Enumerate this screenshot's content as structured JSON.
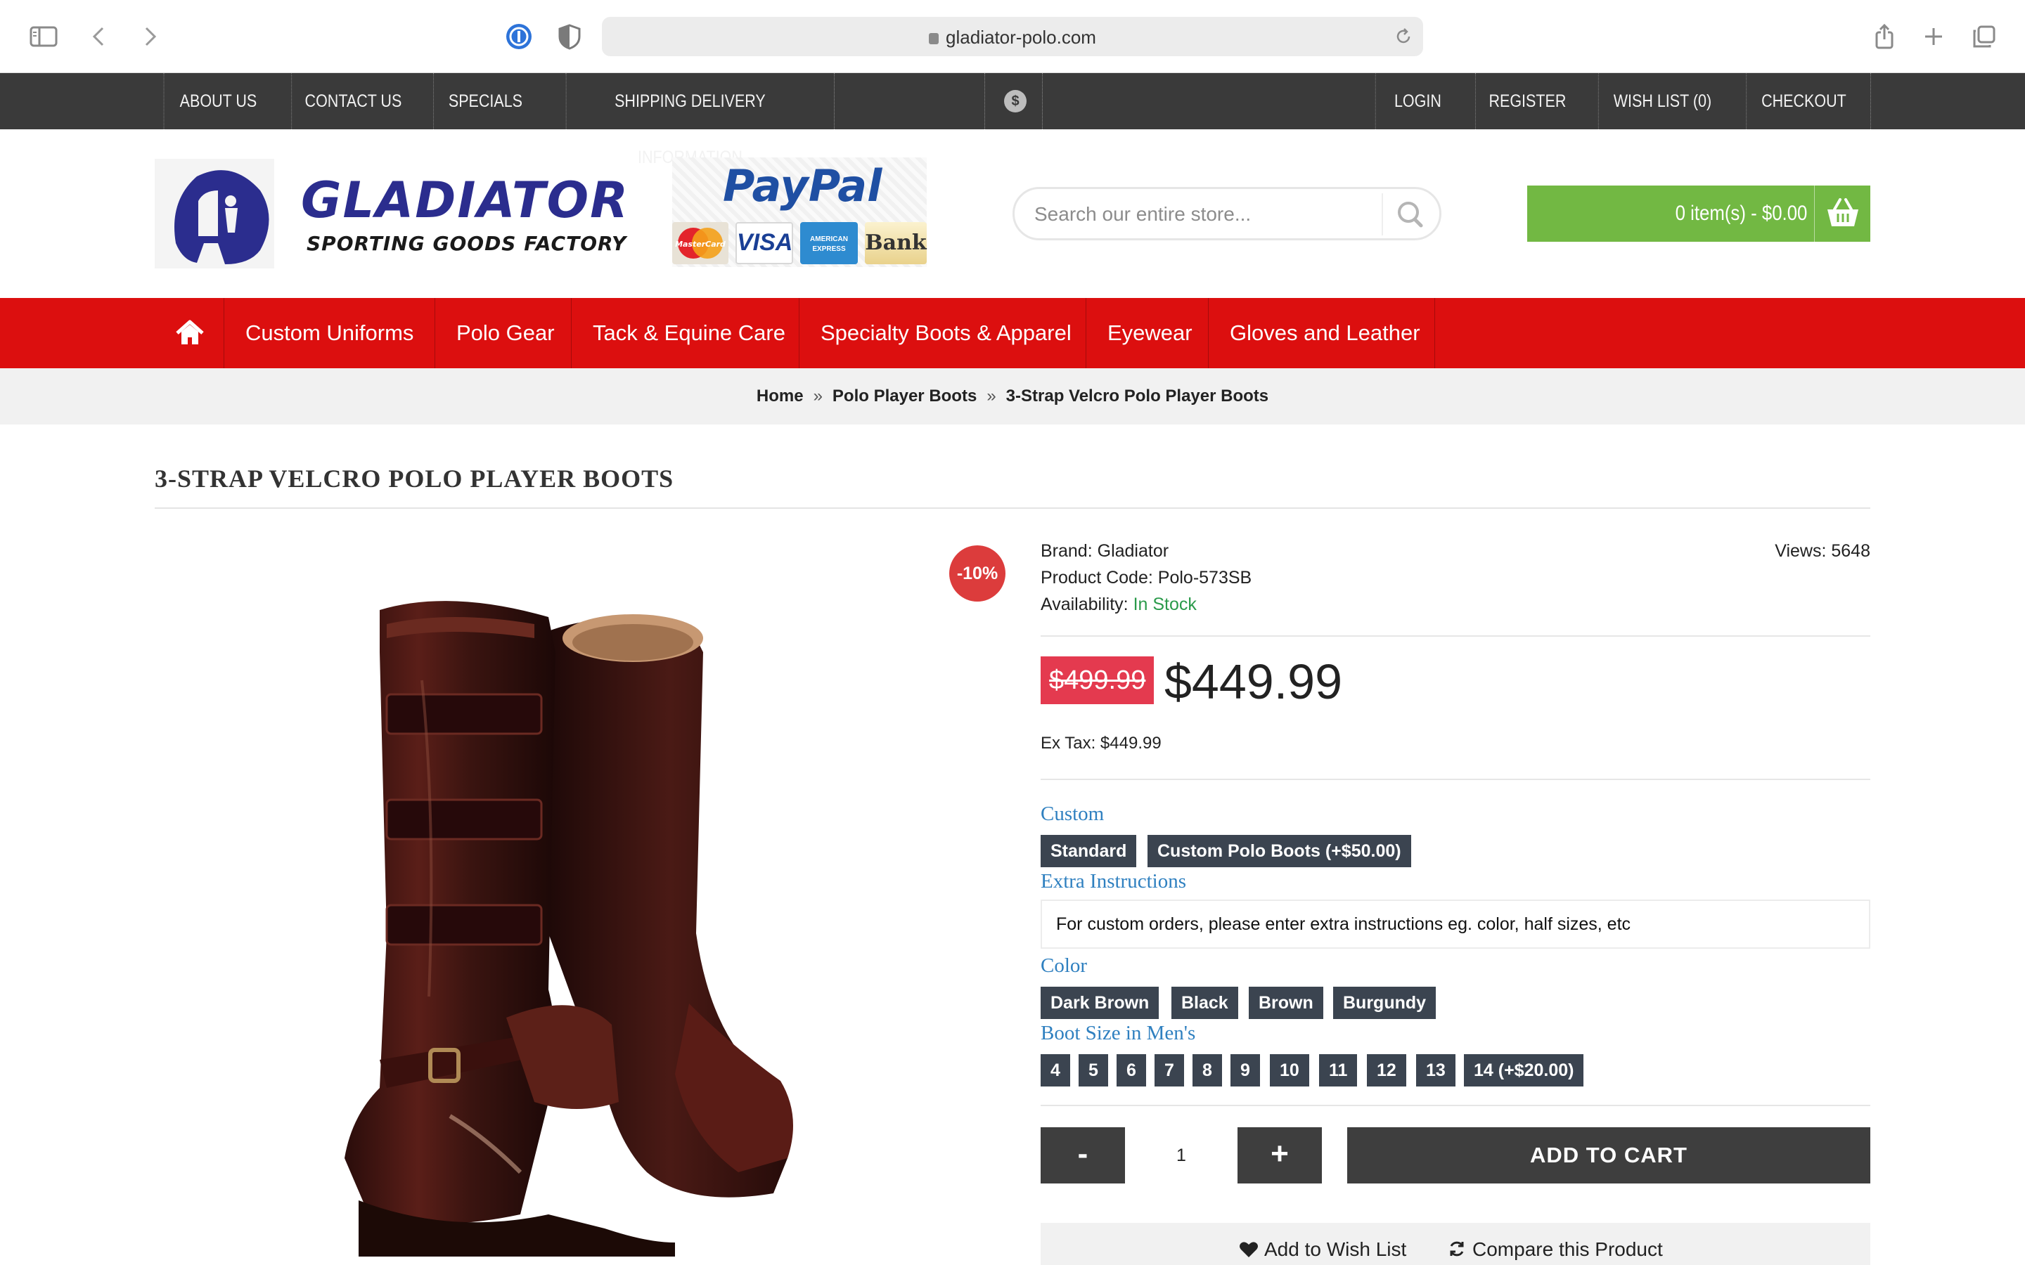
{
  "browser": {
    "url": "gladiator-polo.com"
  },
  "topbar": {
    "left_items": [
      "ABOUT US",
      "CONTACT US",
      "SPECIALS",
      "SHIPPING DELIVERY INFORMATION"
    ],
    "currency_symbol": "$",
    "right_items": [
      "LOGIN",
      "REGISTER",
      "WISH LIST (0)",
      "CHECKOUT"
    ]
  },
  "header": {
    "logo_title": "GLADIATOR",
    "logo_subtitle": "SPORTING GOODS FACTORY",
    "payment_badge": {
      "paypal": "PayPal",
      "cards": [
        "MasterCard",
        "VISA",
        "AMERICAN EXPRESS",
        "Bank"
      ]
    },
    "search_placeholder": "Search our entire store...",
    "cart_summary": "0 item(s) - $0.00"
  },
  "main_nav": {
    "items": [
      "Custom Uniforms",
      "Polo Gear",
      "Tack & Equine Care",
      "Specialty Boots & Apparel",
      "Eyewear",
      "Gloves and Leather"
    ]
  },
  "breadcrumb": [
    "Home",
    "Polo Player Boots",
    "3-Strap Velcro Polo Player Boots"
  ],
  "breadcrumb_separator": "»",
  "product": {
    "title": "3-STRAP VELCRO POLO PLAYER BOOTS",
    "sale_badge": "-10%",
    "brand_label": "Brand:",
    "brand": "Gladiator",
    "code_label": "Product Code:",
    "code": "Polo-573SB",
    "availability_label": "Availability:",
    "availability": "In Stock",
    "views": "Views: 5648",
    "old_price": "$499.99",
    "price": "$449.99",
    "ex_tax": "Ex Tax: $449.99",
    "options": {
      "custom_label": "Custom",
      "custom_values": [
        "Standard",
        "Custom Polo Boots (+$50.00)"
      ],
      "extra_label": "Extra Instructions",
      "extra_placeholder": "For custom orders, please enter extra instructions eg. color, half sizes, etc",
      "color_label": "Color",
      "color_values": [
        "Dark Brown",
        "Black",
        "Brown",
        "Burgundy"
      ],
      "size_label": "Boot Size in Men's",
      "size_values": [
        "4",
        "5",
        "6",
        "7",
        "8",
        "9",
        "10",
        "11",
        "12",
        "13",
        "14 (+$20.00)"
      ]
    },
    "quantity": "1",
    "minus_label": "-",
    "plus_label": "+",
    "add_to_cart": "ADD TO CART",
    "wish_list": "Add to Wish List",
    "compare": "Compare this Product"
  },
  "colors": {
    "topbar": "#3a3a3a",
    "nav_red": "#dc0f0f",
    "cart_green": "#72b843",
    "sale_red": "#dc3c3c",
    "option_label_blue": "#2f80c0",
    "chip_dark": "#3b4450",
    "in_stock_green": "#2a9a4a"
  }
}
